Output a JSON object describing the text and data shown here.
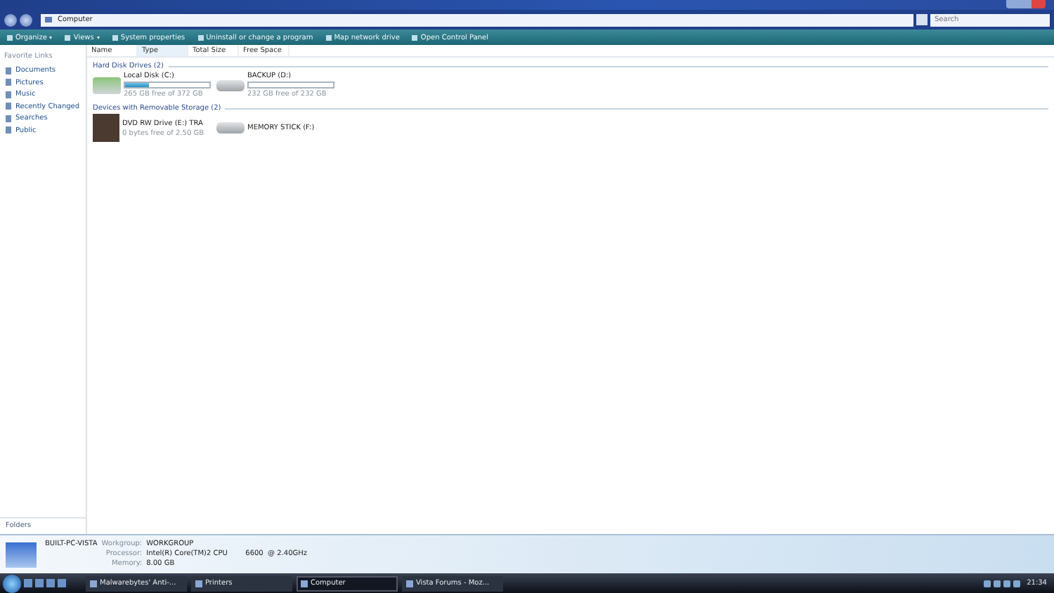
{
  "address_bar": {
    "path": [
      "Computer"
    ],
    "search_placeholder": "Search"
  },
  "toolbar": {
    "items": [
      {
        "label": "Organize",
        "dropdown": true
      },
      {
        "label": "Views",
        "dropdown": true
      },
      {
        "label": "System properties",
        "dropdown": false
      },
      {
        "label": "Uninstall or change a program",
        "dropdown": false
      },
      {
        "label": "Map network drive",
        "dropdown": false
      },
      {
        "label": "Open Control Panel",
        "dropdown": false
      }
    ]
  },
  "sidebar": {
    "title": "Favorite Links",
    "items": [
      {
        "label": "Documents"
      },
      {
        "label": "Pictures"
      },
      {
        "label": "Music"
      },
      {
        "label": "Recently Changed"
      },
      {
        "label": "Searches"
      },
      {
        "label": "Public"
      }
    ],
    "folders_label": "Folders"
  },
  "table": {
    "columns": [
      {
        "label": "Name",
        "selected": false
      },
      {
        "label": "Type",
        "selected": true
      },
      {
        "label": "Total Size",
        "selected": false
      },
      {
        "label": "Free Space",
        "selected": false
      }
    ]
  },
  "groups": [
    {
      "title": "Hard Disk Drives (2)",
      "drives": [
        {
          "kind": "system-disk",
          "name": "Local Disk (C:)",
          "level": 0.29,
          "free": "265 GB free of 372 GB"
        },
        {
          "kind": "disk",
          "name": "BACKUP  (D:)",
          "level": 0,
          "free": "232 GB free of 232 GB"
        }
      ]
    },
    {
      "title": "Devices with Removable Storage (2)",
      "drives": [
        {
          "kind": "media",
          "name": "DVD RW Drive (E:) TRA",
          "free": "0 bytes free of 2.50 GB"
        },
        {
          "kind": "removable",
          "name": "MEMORY STICK (F:)"
        }
      ]
    }
  ],
  "details": {
    "computer_name": "BUILT-PC-VISTA",
    "fields": [
      {
        "label": "Workgroup:",
        "value": "WORKGROUP"
      },
      {
        "label": "Processor:",
        "value": "Intel(R) Core(TM)2 CPU        6600  @ 2.40GHz"
      },
      {
        "label": "Memory:",
        "value": "8.00 GB"
      }
    ]
  },
  "taskbar": {
    "tasks": [
      {
        "label": "Malwarebytes' Anti-...",
        "selected": false
      },
      {
        "label": "Printers",
        "selected": false
      },
      {
        "label": "Computer",
        "selected": true
      },
      {
        "label": "Vista Forums - Moz...",
        "selected": false
      }
    ],
    "time": "21:34"
  }
}
